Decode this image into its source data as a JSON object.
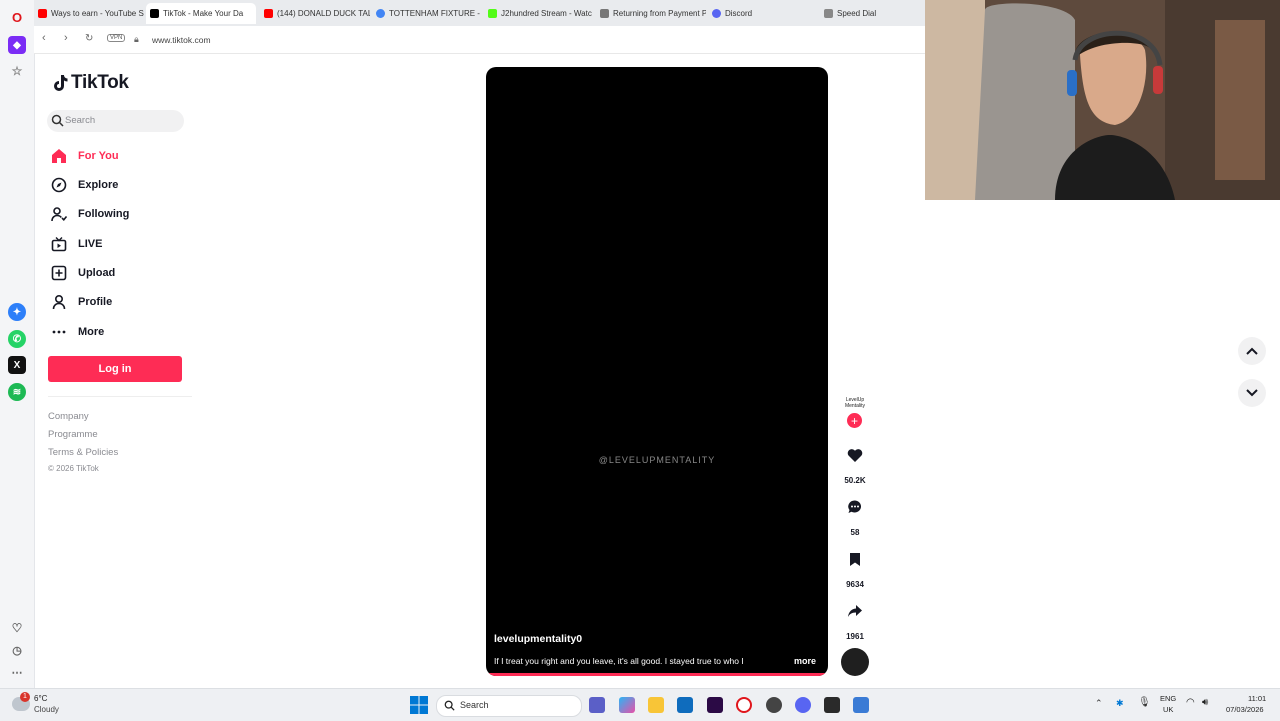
{
  "browser": {
    "tabs": [
      {
        "label": "Ways to earn - YouTube S",
        "favicon_color": "#ff0000"
      },
      {
        "label": "TikTok - Make Your Da",
        "favicon_color": "#000000",
        "active": true
      },
      {
        "label": "(144) DONALD DUCK TAL",
        "favicon_color": "#ff0000"
      },
      {
        "label": "TOTTENHAM FIXTURE - G",
        "favicon_color": "#4285f4"
      },
      {
        "label": "J2hundred Stream - Watc",
        "favicon_color": "#53fc18"
      },
      {
        "label": "Returning from Payment P",
        "favicon_color": "#777777"
      },
      {
        "label": "Discord",
        "favicon_color": "#5865f2"
      },
      {
        "label": "Speed Dial",
        "favicon_color": "#888888"
      }
    ],
    "vpn_label": "VPN",
    "url": "www.tiktok.com"
  },
  "tiktok": {
    "logo_text": "TikTok",
    "search_placeholder": "Search",
    "nav": [
      {
        "label": "For You",
        "icon": "home-icon",
        "active": true
      },
      {
        "label": "Explore",
        "icon": "compass-icon"
      },
      {
        "label": "Following",
        "icon": "following-icon"
      },
      {
        "label": "LIVE",
        "icon": "live-icon"
      },
      {
        "label": "Upload",
        "icon": "upload-icon"
      },
      {
        "label": "Profile",
        "icon": "profile-icon"
      },
      {
        "label": "More",
        "icon": "more-icon"
      }
    ],
    "login_label": "Log in",
    "footer": {
      "company": "Company",
      "programme": "Programme",
      "terms": "Terms & Policies",
      "copyright": "© 2026 TikTok"
    },
    "video": {
      "watermark": "@LEVELUPMENTALITY",
      "author": "levelupmentality0",
      "caption": "If I treat you right and you leave, it's all good. I stayed true to who I",
      "more_label": "more",
      "creator_badge": "LevelUp Mentality"
    },
    "actions": {
      "likes": "50.2K",
      "comments": "58",
      "saves": "9634",
      "shares": "1961"
    },
    "accent_color": "#fe2c55"
  },
  "taskbar": {
    "weather_temp": "6°C",
    "weather_desc": "Cloudy",
    "weather_badge": "1",
    "search_label": "Search",
    "lang_top": "ENG",
    "lang_bottom": "UK",
    "time": "11:01",
    "date": "07/03/2026"
  }
}
